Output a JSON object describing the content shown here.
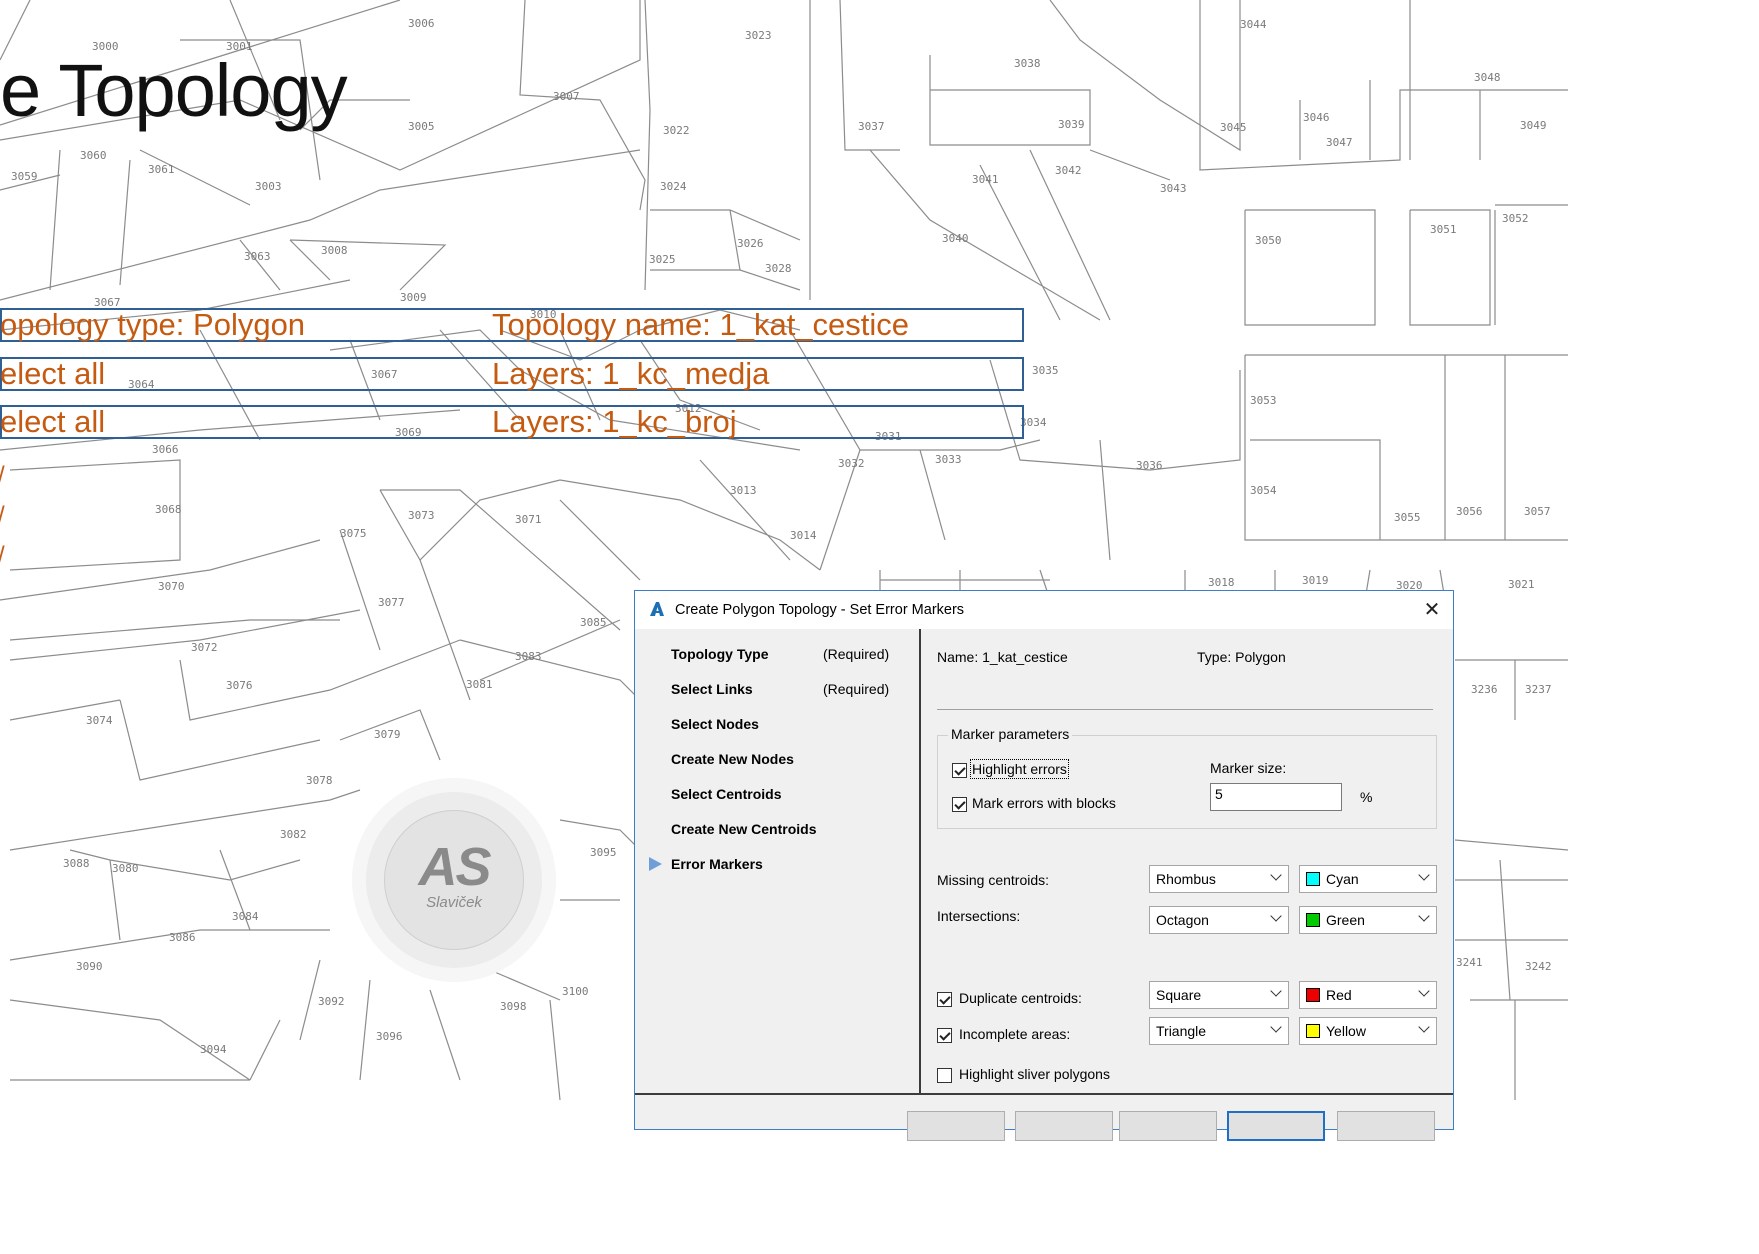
{
  "slide": {
    "title": "e Topology",
    "rows": [
      {
        "left": "opology type: Polygon",
        "right": "Topology name: 1_kat_cestice"
      },
      {
        "left": "elect all",
        "right": "Layers: 1_kc_medja"
      },
      {
        "left": "elect all",
        "right": "Layers: 1_kc_broj"
      }
    ],
    "ticks": [
      "/",
      "/",
      "/"
    ]
  },
  "map_labels": [
    "3006",
    "3000",
    "3001",
    "3007",
    "3023",
    "3044",
    "3038",
    "3048",
    "3005",
    "3022",
    "3037",
    "3039",
    "3045",
    "3046",
    "3047",
    "3049",
    "3060",
    "3061",
    "3059",
    "3003",
    "3024",
    "3041",
    "3042",
    "3043",
    "3063",
    "3008",
    "3026",
    "3025",
    "3028",
    "3040",
    "3050",
    "3051",
    "3052",
    "3067",
    "3009",
    "3010",
    "3035",
    "3064",
    "3067",
    "3053",
    "3069",
    "3012",
    "3031",
    "3034",
    "3066",
    "3032",
    "3033",
    "3036",
    "3013",
    "3054",
    "3068",
    "3073",
    "3071",
    "3075",
    "3014",
    "3055",
    "3056",
    "3057",
    "3070",
    "3077",
    "3018",
    "3019",
    "3020",
    "3021",
    "3085",
    "3072",
    "3083",
    "3076",
    "3081",
    "3236",
    "3237",
    "3074",
    "3079",
    "3078",
    "3082",
    "3095",
    "3088",
    "3080",
    "3084",
    "3086",
    "3090",
    "3092",
    "3098",
    "3100",
    "3096",
    "3094",
    "3241",
    "3242"
  ],
  "logo": {
    "mark": "AS",
    "sub": "Slaviček"
  },
  "dialog": {
    "title": "Create Polygon Topology - Set Error Markers",
    "close": "✕",
    "steps": [
      {
        "label": "Topology Type",
        "req": "(Required)"
      },
      {
        "label": "Select Links",
        "req": "(Required)"
      },
      {
        "label": "Select Nodes",
        "req": ""
      },
      {
        "label": "Create New Nodes",
        "req": ""
      },
      {
        "label": "Select Centroids",
        "req": ""
      },
      {
        "label": "Create New Centroids",
        "req": ""
      },
      {
        "label": "Error Markers",
        "req": ""
      }
    ],
    "name": "Name: 1_kat_cestice",
    "type": "Type: Polygon",
    "marker_group": "Marker parameters",
    "highlight_errors": {
      "label": "Highlight errors",
      "checked": true
    },
    "mark_blocks": {
      "label": "Mark errors with blocks",
      "checked": true
    },
    "marker_size_label": "Marker size:",
    "marker_size_value": "5",
    "percent": "%",
    "errors": [
      {
        "label": "Missing centroids:",
        "checkbox": false,
        "shape": "Rhombus",
        "color": "Cyan",
        "hex": "#00ffff"
      },
      {
        "label": "Intersections:",
        "checkbox": false,
        "shape": "Octagon",
        "color": "Green",
        "hex": "#00cc00"
      },
      {
        "label": "Duplicate centroids:",
        "checkbox": true,
        "checked": true,
        "shape": "Square",
        "color": "Red",
        "hex": "#ee0000"
      },
      {
        "label": "Incomplete areas:",
        "checkbox": true,
        "checked": true,
        "shape": "Triangle",
        "color": "Yellow",
        "hex": "#ffff00"
      }
    ],
    "sliver": {
      "label": "Highlight sliver polygons",
      "checked": false
    }
  },
  "colors": {
    "accent": "#c55a11",
    "box_border": "#2f5f93",
    "dialog_border": "#3c7fc6"
  }
}
